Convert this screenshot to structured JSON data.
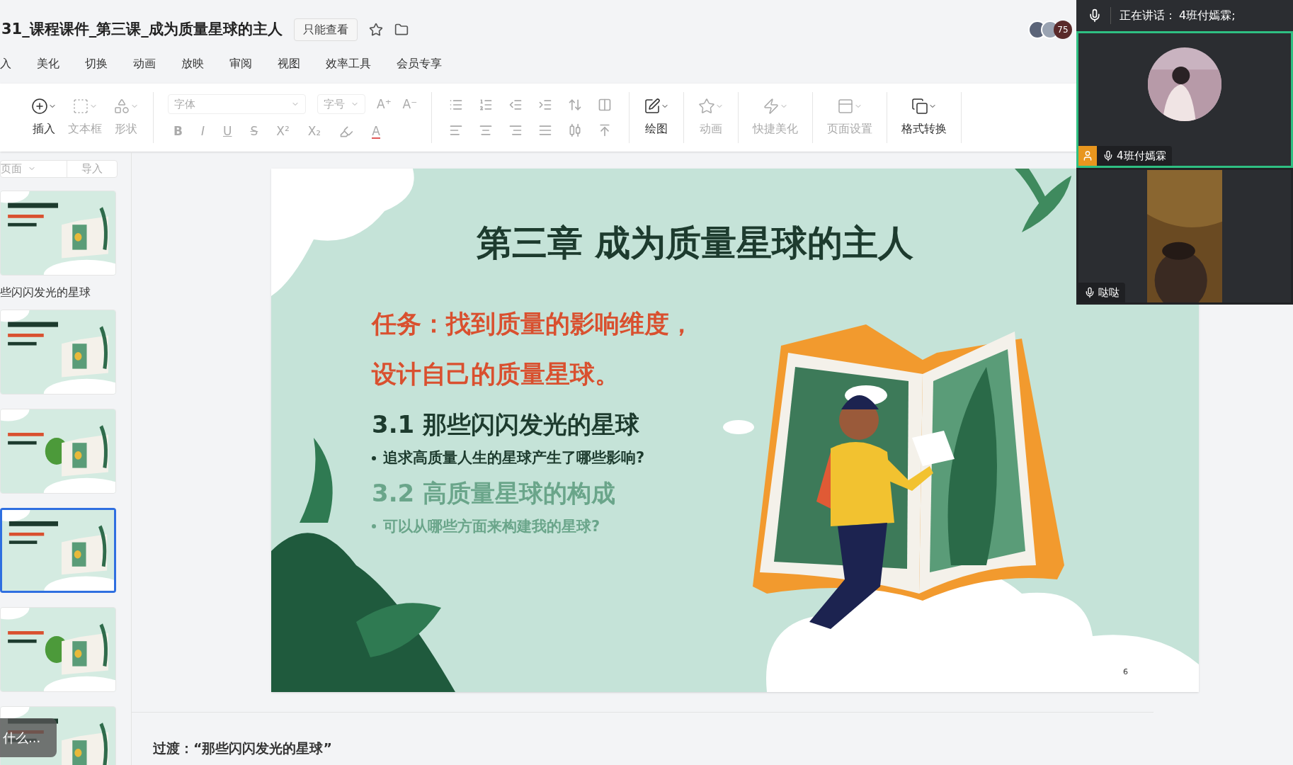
{
  "document": {
    "title": "31_课程课件_第三课_成为质量星球的主人",
    "mode_badge": "只能查看"
  },
  "collaborators": {
    "count": "75"
  },
  "menu": [
    {
      "label": "入"
    },
    {
      "label": "美化"
    },
    {
      "label": "切换"
    },
    {
      "label": "动画"
    },
    {
      "label": "放映"
    },
    {
      "label": "审阅"
    },
    {
      "label": "视图"
    },
    {
      "label": "效率工具"
    },
    {
      "label": "会员专享"
    }
  ],
  "toolbar": {
    "insert_group": [
      {
        "label": "插入",
        "disabled": false
      },
      {
        "label": "文本框",
        "disabled": true
      },
      {
        "label": "形状",
        "disabled": true
      }
    ],
    "font_placeholder": "字体",
    "size_placeholder": "字号",
    "size_buttons": [
      "A⁺",
      "A⁻"
    ],
    "format_buttons": [
      "B",
      "I",
      "U",
      "S",
      "X²",
      "X₂"
    ],
    "font_color_button": "A",
    "right_group": [
      {
        "label": "绘图",
        "disabled": false
      },
      {
        "label": "动画",
        "disabled": true
      },
      {
        "label": "快捷美化",
        "disabled": true
      },
      {
        "label": "页面设置",
        "disabled": true
      },
      {
        "label": "格式转换",
        "disabled": false
      }
    ]
  },
  "sidebar": {
    "page_dropdown": "页面",
    "import_button": "导入",
    "items": [
      {
        "kind": "slide",
        "selected": false
      },
      {
        "kind": "section",
        "label": "些闪闪发光的星球"
      },
      {
        "kind": "slide",
        "selected": false
      },
      {
        "kind": "slide",
        "selected": false
      },
      {
        "kind": "slide",
        "selected": true
      },
      {
        "kind": "slide",
        "selected": false
      },
      {
        "kind": "slide",
        "selected": false
      }
    ],
    "tooltip": "什么..."
  },
  "slide": {
    "title": "第三章 成为质量星球的主人",
    "task_lines": [
      "任务：找到质量的影响维度，",
      "设计自己的质量星球。"
    ],
    "sections": [
      {
        "heading": "3.1 那些闪闪发光的星球",
        "bullet": "追求高质量人生的星球产生了哪些影响?",
        "active": true
      },
      {
        "heading": "3.2 高质量星球的构成",
        "bullet": "可以从哪些方面来构建我的星球?",
        "active": false
      }
    ],
    "page_number": "6"
  },
  "notes": {
    "text": "过渡：“那些闪闪发光的星球”"
  },
  "call": {
    "speaking_label": "正在讲话：",
    "speaker": "4班付嫣霖;",
    "participants": [
      {
        "name": "4班付嫣霖",
        "speaking": true,
        "host": true,
        "kind": "avatar"
      },
      {
        "name": "哒哒",
        "speaking": false,
        "host": false,
        "kind": "video"
      }
    ]
  }
}
